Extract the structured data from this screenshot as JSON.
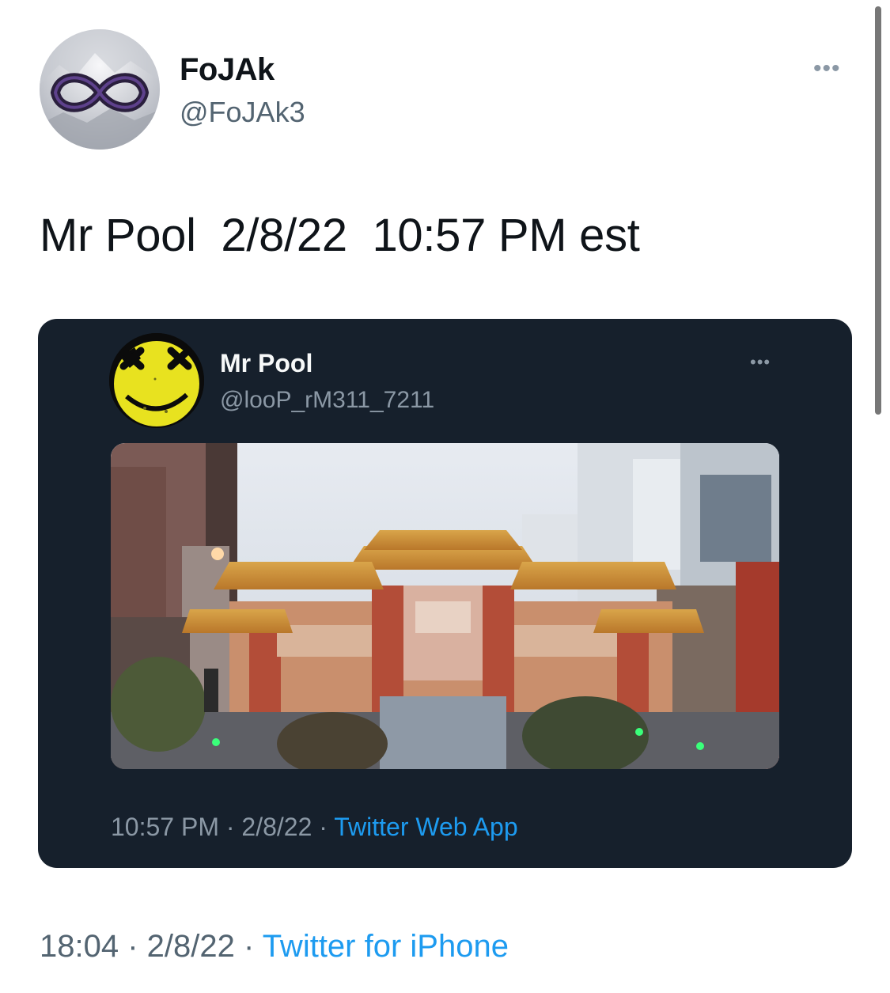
{
  "tweet": {
    "author_name": "FoJAk",
    "author_handle": "@FoJAk3",
    "text": "Mr Pool  2/8/22  10:57 PM est",
    "time": "18:04",
    "date": "2/8/22",
    "source": "Twitter for iPhone",
    "separator": " · "
  },
  "quoted_tweet": {
    "author_name": "Mr Pool",
    "author_handle": "@looP_rM311_7211",
    "time": "10:57 PM",
    "date": "2/8/22",
    "source": "Twitter Web App",
    "separator": " · ",
    "media": "photo-of-chinatown-gate"
  },
  "icons": {
    "more_top": "more-icon",
    "more_quote": "more-icon",
    "avatar_author": "infinity-logo",
    "avatar_quote": "yellow-smiley-face"
  },
  "colors": {
    "link": "#1d9bf0",
    "card_background": "#16202c",
    "secondary_text": "#536471"
  }
}
